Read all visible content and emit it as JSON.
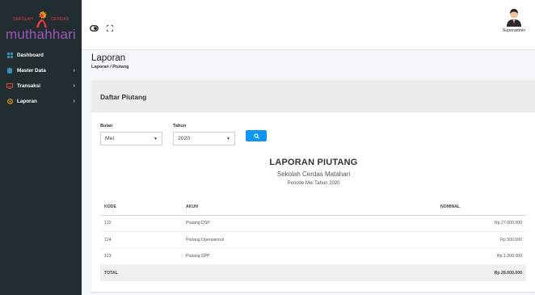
{
  "sidebar": {
    "logo": {
      "small_left": "SEKOLAH",
      "small_right": "CERDAS",
      "name": "muthahhari"
    },
    "items": [
      {
        "label": "Dashboard",
        "icon": "dashboard-icon",
        "has_arrow": false
      },
      {
        "label": "Master Data",
        "icon": "database-icon",
        "has_arrow": true,
        "arrow": "›"
      },
      {
        "label": "Transaksi",
        "icon": "monitor-icon",
        "has_arrow": true,
        "arrow": "›"
      },
      {
        "label": "Laporan",
        "icon": "circle-icon",
        "has_arrow": true,
        "arrow": "›"
      }
    ]
  },
  "topbar": {
    "user_name": "Superadmin"
  },
  "header": {
    "title": "Laporan",
    "breadcrumb": "Laporan / Piutang"
  },
  "card": {
    "title": "Daftar Piutang"
  },
  "filters": {
    "bulan_label": "Bulan",
    "bulan_value": "Mei",
    "tahun_label": "Tahun",
    "tahun_value": "2020",
    "caret": "▼"
  },
  "report": {
    "title": "LAPORAN PIUTANG",
    "school": "Sekolah Cerdas Matahari",
    "period": "Periode Mei Tahun 2020"
  },
  "table": {
    "headers": {
      "kode": "KODE",
      "akun": "AKUN",
      "nominal": "NOMINAL"
    },
    "rows": [
      {
        "kode": "122",
        "akun": "Piutang DSP",
        "nominal": "Rp 27.000.000"
      },
      {
        "kode": "124",
        "akun": "Piutang Operasional",
        "nominal": "Rp 500.000"
      },
      {
        "kode": "123",
        "akun": "Piutang SPP",
        "nominal": "Rp 1.000.000"
      }
    ],
    "total_label": "TOTAL",
    "total_value": "Rp 28.600.000"
  },
  "colors": {
    "sidebar_bg": "#222d32",
    "primary_button": "#0d97f1",
    "logo_red": "#e23b45",
    "logo_purple": "#9a57b5",
    "dashboard_icon": "#3c8dbc",
    "database_icon": "#3c8dbc",
    "monitor_icon": "#dd4b39",
    "laporan_icon": "#f39c12"
  }
}
